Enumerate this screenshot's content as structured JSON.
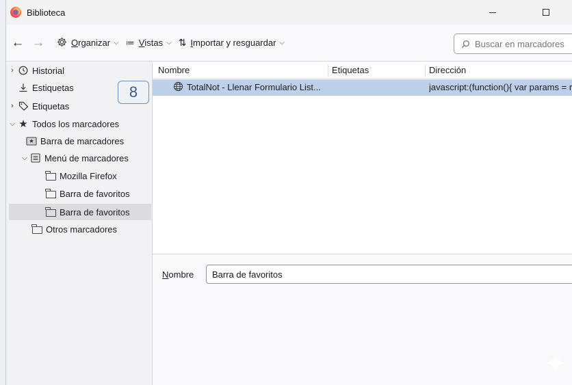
{
  "window": {
    "title": "Biblioteca",
    "minimize_glyph": "—",
    "maximize_glyph": "☐"
  },
  "toolbar": {
    "organize": {
      "prefix": "",
      "accel": "O",
      "rest": "rganizar"
    },
    "views": {
      "accel": "V",
      "rest": "istas"
    },
    "import": {
      "accel": "I",
      "rest": "mportar y resguardar"
    },
    "search_placeholder": "Buscar en marcadores"
  },
  "sidebar": {
    "items": [
      {
        "label": "Historial",
        "icon": "clock-icon"
      },
      {
        "label": "Estiquetas",
        "icon": "download-icon"
      },
      {
        "label": "Etiquetas",
        "icon": "tag-icon"
      },
      {
        "label": "Todos los marcadores",
        "icon": "star-icon"
      },
      {
        "label": "Barra de marcadores",
        "icon": "bookmarks-bar-icon"
      },
      {
        "label": "Menú de marcadores",
        "icon": "bookmarks-menu-icon"
      },
      {
        "label": "Mozilla Firefox",
        "icon": "folder-icon"
      },
      {
        "label": "Barra de favoritos",
        "icon": "folder-icon"
      },
      {
        "label": "Barra de favoritos",
        "icon": "folder-icon"
      },
      {
        "label": "Otros marcadores",
        "icon": "folder-icon"
      }
    ],
    "callout_number": "8"
  },
  "list": {
    "columns": [
      "Nombre",
      "Etiquetas",
      "Dirección"
    ],
    "rows": [
      {
        "name": "TotalNot - Llenar Formulario List...",
        "tags": "",
        "address": "javascript:(function(){   var params = r"
      }
    ]
  },
  "details": {
    "name_label_accel": "N",
    "name_label_rest": "ombre",
    "name_value": "Barra de favoritos"
  },
  "colors": {
    "selected_row": "#bcd0ea",
    "selected_tree": "#dcdcde",
    "callout_border": "#6b8fbd"
  }
}
